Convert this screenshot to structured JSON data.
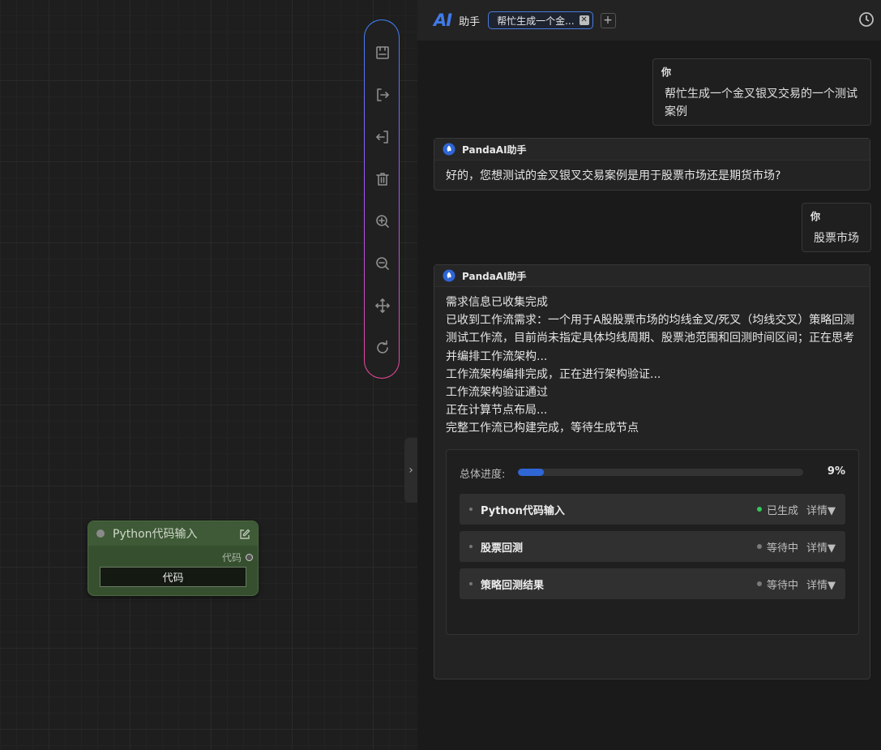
{
  "canvas": {
    "toolbar": [
      "save-icon",
      "export-icon",
      "import-icon",
      "delete-icon",
      "zoom-in-icon",
      "zoom-out-icon",
      "fit-view-icon",
      "reset-icon"
    ],
    "collapse_glyph": "›",
    "node": {
      "title": "Python代码输入",
      "output_label": "代码",
      "field_value": "代码"
    }
  },
  "panel": {
    "logo": "AI",
    "name": "助手",
    "tab_label": "帮忙生成一个金...",
    "tab_close": "✕",
    "add_tab": "+"
  },
  "messages": {
    "user1": {
      "author": "你",
      "lines": [
        "帮忙生成一个金叉银叉交易的一个测试",
        "案例"
      ]
    },
    "ai1": {
      "author": "PandaAI助手",
      "text": "好的，您想测试的金叉银叉交易案例是用于股票市场还是期货市场?"
    },
    "user2": {
      "author": "你",
      "text": "股票市场"
    },
    "ai2": {
      "author": "PandaAI助手",
      "lines": [
        "需求信息已收集完成",
        "已收到工作流需求：一个用于A股股票市场的均线金叉/死叉（均线交叉）策略回测",
        "测试工作流，目前尚未指定具体均线周期、股票池范围和回测时间区间；正在思考",
        "并编排工作流架构...",
        "工作流架构编排完成，正在进行架构验证...",
        "工作流架构验证通过",
        "正在计算节点布局...",
        "完整工作流已构建完成，等待生成节点"
      ]
    }
  },
  "progress": {
    "label": "总体进度:",
    "value": 0.09,
    "percent_text": "9%",
    "steps": [
      {
        "name": "Python代码输入",
        "status": "已生成",
        "status_color": "#35c75a",
        "detail": "详情▼"
      },
      {
        "name": "股票回测",
        "status": "等待中",
        "status_color": "#7a7a7a",
        "detail": "详情▼"
      },
      {
        "name": "策略回测结果",
        "status": "等待中",
        "status_color": "#7a7a7a",
        "detail": "详情▼"
      }
    ]
  },
  "colors": {
    "accent": "#3f7be8",
    "node_bg": "#36502f",
    "progress_fill": "#2f66d6"
  }
}
